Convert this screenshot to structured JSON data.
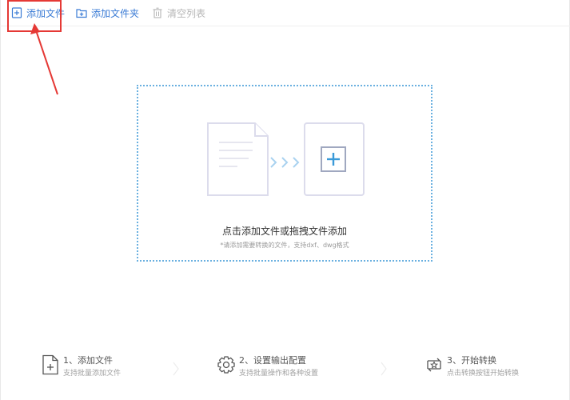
{
  "toolbar": {
    "add_file": "添加文件",
    "add_folder": "添加文件夹",
    "clear_list": "清空列表"
  },
  "dropzone": {
    "title": "点击添加文件或拖拽文件添加",
    "hint": "*请添加需要转换的文件，支持dxf、dwg格式"
  },
  "steps": [
    {
      "title": "1、添加文件",
      "desc": "支持批量添加文件",
      "icon": "file-add-icon"
    },
    {
      "title": "2、设置输出配置",
      "desc": "支持批量操作和各种设置",
      "icon": "gear-icon"
    },
    {
      "title": "3、开始转换",
      "desc": "点击转换按钮开始转换",
      "icon": "convert-icon"
    }
  ],
  "colors": {
    "accent": "#3a7bd5",
    "annotation": "#e53935",
    "dropzone_border": "#6ab0e0",
    "disabled": "#b5b5b5"
  }
}
